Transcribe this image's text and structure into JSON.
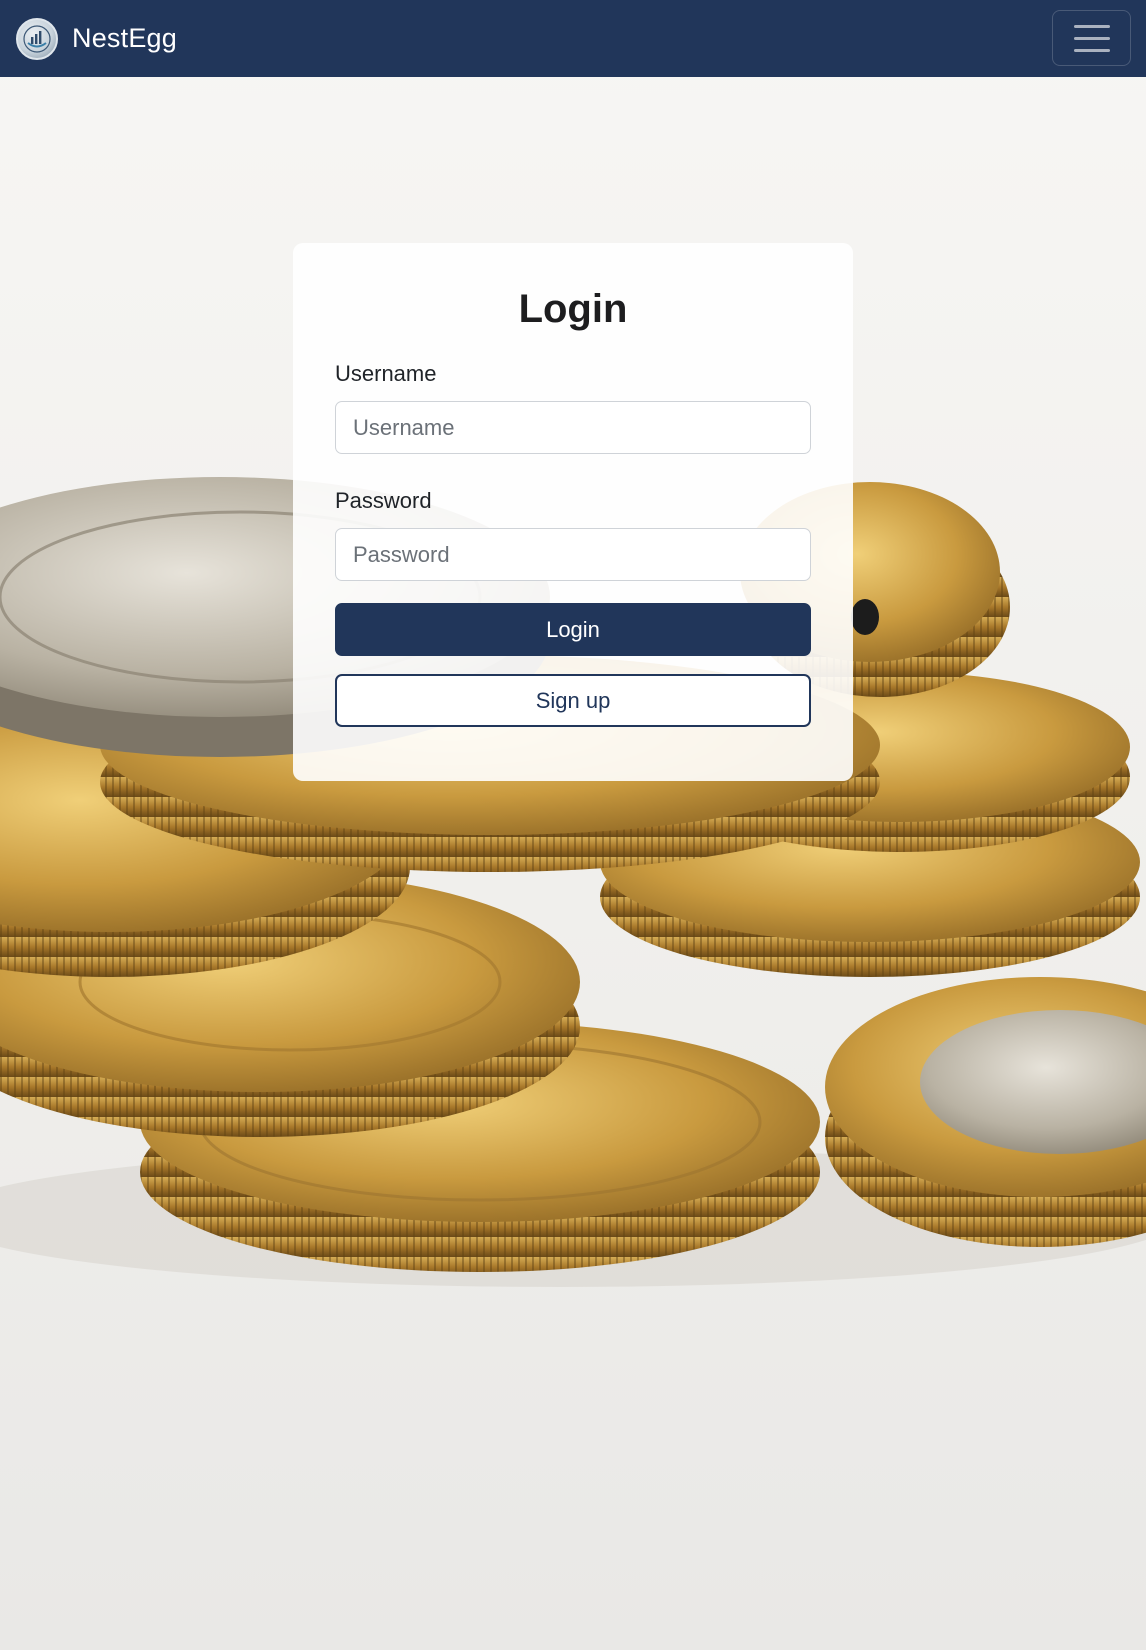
{
  "navbar": {
    "brand_name": "NestEgg",
    "logo_icon": "nest-egg-logo-icon",
    "menu_icon": "hamburger-menu-icon"
  },
  "login": {
    "title": "Login",
    "username_label": "Username",
    "username_placeholder": "Username",
    "username_value": "",
    "password_label": "Password",
    "password_placeholder": "Password",
    "password_value": "",
    "login_button": "Login",
    "signup_button": "Sign up"
  },
  "colors": {
    "navbar": "#21365a",
    "primary_button": "#21365a",
    "card_background": "#ffffff"
  }
}
